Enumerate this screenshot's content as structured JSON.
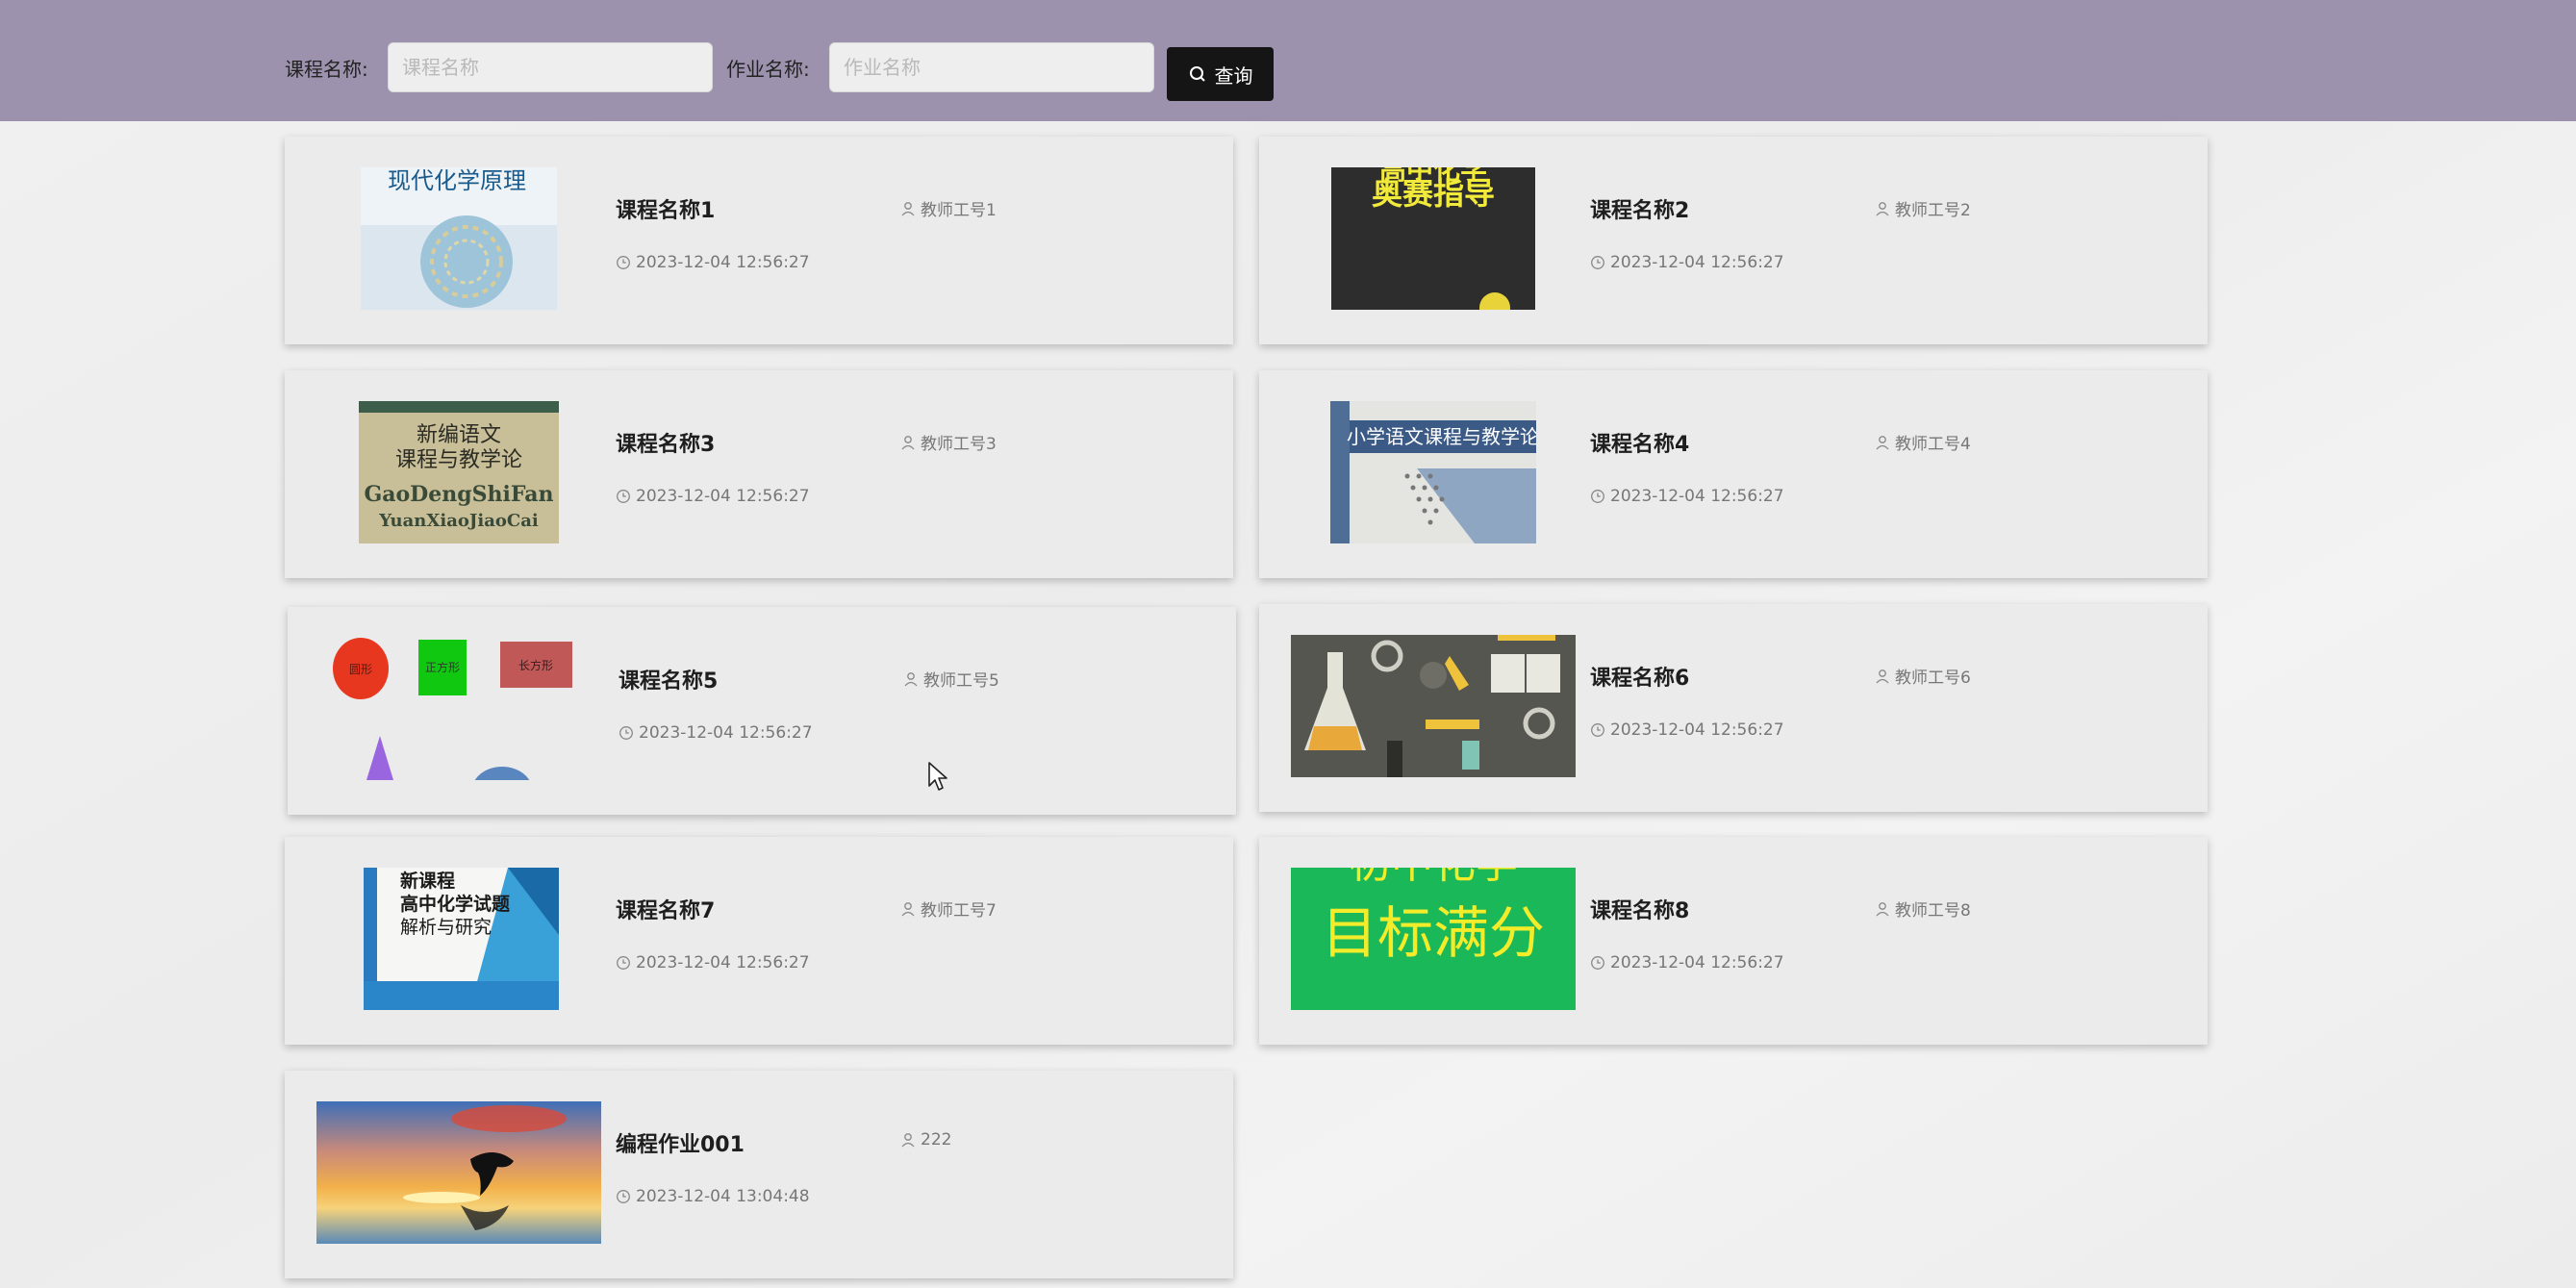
{
  "search": {
    "course_label": "课程名称:",
    "course_placeholder": "课程名称",
    "homework_label": "作业名称:",
    "homework_placeholder": "作业名称",
    "query_label": "查询",
    "query_icon": "search-icon"
  },
  "colors": {
    "topbar": "#9c92ad",
    "query_button": "#151515",
    "card": "#ebebeb"
  },
  "cards": [
    {
      "name": "课程名称1",
      "teacher": "教师工号1",
      "time": "2023-12-04 12:56:27",
      "cover_text": [
        "现代化学原理"
      ],
      "cover_description": "textbook cover with molecular cage structure"
    },
    {
      "name": "课程名称2",
      "teacher": "教师工号2",
      "time": "2023-12-04 12:56:27",
      "cover_text": [
        "高中化学",
        "奥赛指导"
      ],
      "cover_description": "dark textbook cover with yellow title"
    },
    {
      "name": "课程名称3",
      "teacher": "教师工号3",
      "time": "2023-12-04 12:56:27",
      "cover_text": [
        "新编语文",
        "课程与教学论",
        "GaoDengShiFan",
        "YuanXiaoJiaoCai"
      ],
      "cover_description": "beige textbook cover"
    },
    {
      "name": "课程名称4",
      "teacher": "教师工号4",
      "time": "2023-12-04 12:56:27",
      "cover_text": [
        "小学语文课程与教学论"
      ],
      "cover_description": "textbook cover with dotted triangle pattern"
    },
    {
      "name": "课程名称5",
      "teacher": "教师工号5",
      "time": "2023-12-04 12:56:27",
      "cover_text": [
        "圆形",
        "正方形",
        "长方形"
      ],
      "cover_description": "simple colored geometric shapes"
    },
    {
      "name": "课程名称6",
      "teacher": "教师工号6",
      "time": "2023-12-04 12:56:27",
      "cover_text": [],
      "cover_description": "laboratory equipment illustration"
    },
    {
      "name": "课程名称7",
      "teacher": "教师工号7",
      "time": "2023-12-04 12:56:27",
      "cover_text": [
        "新课程",
        "高中化学试题",
        "解析与研究"
      ],
      "cover_description": "blue and white textbook cover"
    },
    {
      "name": "课程名称8",
      "teacher": "教师工号8",
      "time": "2023-12-04 12:56:27",
      "cover_text": [
        "初中化学",
        "目标满分"
      ],
      "cover_description": "green cover with yellow text"
    },
    {
      "name": "编程作业001",
      "teacher": "222",
      "time": "2023-12-04 13:04:48",
      "cover_text": [],
      "cover_description": "dolphin silhouette at sunset over water"
    }
  ]
}
